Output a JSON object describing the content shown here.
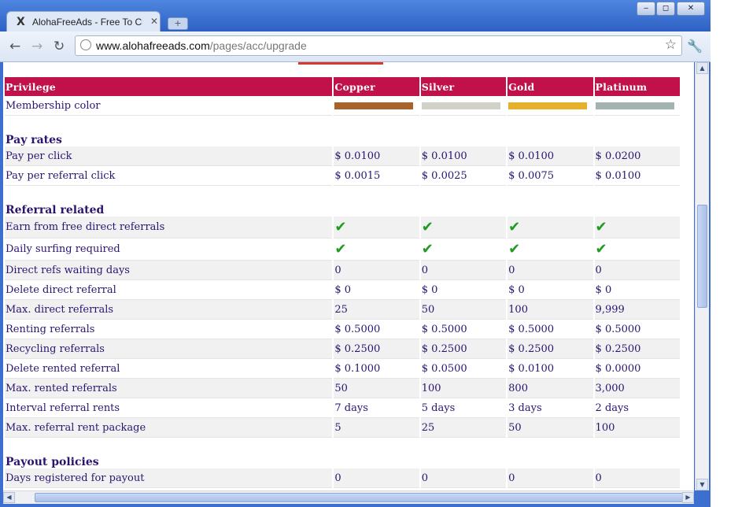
{
  "browser": {
    "tab_title": "AlohaFreeAds - Free To Click",
    "tab_logo": "X",
    "url_host": "www.alohafreeads.com",
    "url_path": "/pages/acc/upgrade",
    "window_buttons": {
      "minimize": "‒",
      "maximize": "◻",
      "close": "✕"
    }
  },
  "table": {
    "headers": [
      "Privilege",
      "Copper",
      "Silver",
      "Gold",
      "Platinum"
    ],
    "membership_color": {
      "label": "Membership color",
      "colors": [
        "#a8632c",
        "#d2d1c8",
        "#e5b12a",
        "#a2b3b1"
      ]
    },
    "sections": [
      {
        "title": "Pay rates",
        "rows": [
          {
            "label": "Pay per click",
            "values": [
              "$ 0.0100",
              "$ 0.0100",
              "$ 0.0100",
              "$ 0.0200"
            ]
          },
          {
            "label": "Pay per referral click",
            "values": [
              "$ 0.0015",
              "$ 0.0025",
              "$ 0.0075",
              "$ 0.0100"
            ]
          }
        ]
      },
      {
        "title": "Referral related",
        "rows": [
          {
            "label": "Earn from free direct referrals",
            "check": true
          },
          {
            "label": "Daily surfing required",
            "check": true
          },
          {
            "label": "Direct refs waiting days",
            "values": [
              "0",
              "0",
              "0",
              "0"
            ]
          },
          {
            "label": "Delete direct referral",
            "values": [
              "$ 0",
              "$ 0",
              "$ 0",
              "$ 0"
            ]
          },
          {
            "label": "Max. direct referrals",
            "values": [
              "25",
              "50",
              "100",
              "9,999"
            ]
          },
          {
            "label": "Renting referrals",
            "values": [
              "$ 0.5000",
              "$ 0.5000",
              "$ 0.5000",
              "$ 0.5000"
            ]
          },
          {
            "label": "Recycling referrals",
            "values": [
              "$ 0.2500",
              "$ 0.2500",
              "$ 0.2500",
              "$ 0.2500"
            ]
          },
          {
            "label": "Delete rented referral",
            "values": [
              "$ 0.1000",
              "$ 0.0500",
              "$ 0.0100",
              "$ 0.0000"
            ]
          },
          {
            "label": "Max. rented referrals",
            "values": [
              "50",
              "100",
              "800",
              "3,000"
            ]
          },
          {
            "label": "Interval referral rents",
            "values": [
              "7 days",
              "5 days",
              "3 days",
              "2 days"
            ]
          },
          {
            "label": "Max. referral rent package",
            "values": [
              "5",
              "25",
              "50",
              "100"
            ]
          }
        ]
      },
      {
        "title": "Payout policies",
        "rows": [
          {
            "label": "Days registered for payout",
            "values": [
              "0",
              "0",
              "0",
              "0"
            ]
          }
        ]
      }
    ],
    "check_glyph": "✔"
  }
}
